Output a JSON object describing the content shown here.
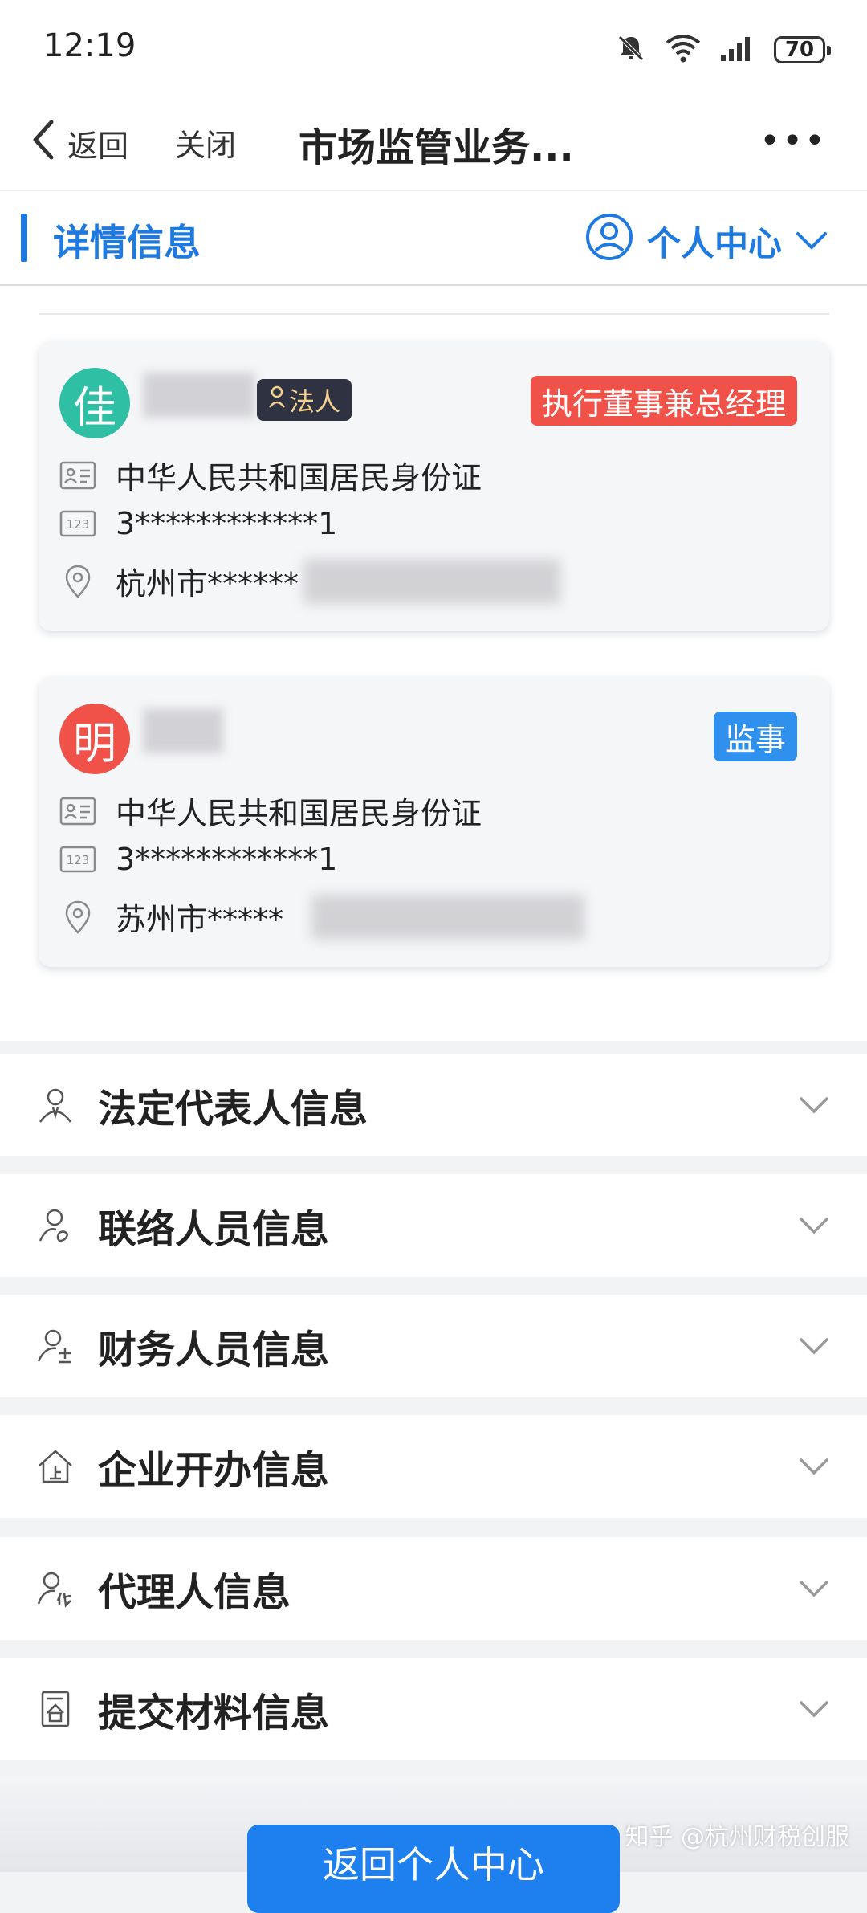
{
  "status_bar": {
    "time": "12:19",
    "battery": "70"
  },
  "nav": {
    "back_label": "返回",
    "close_label": "关闭",
    "title": "市场监管业务...",
    "more_label": "•••"
  },
  "tab": {
    "title": "详情信息",
    "personal_center": "个人中心"
  },
  "people": [
    {
      "avatar_char": "佳",
      "avatar_color": "#2ebfa5",
      "legal_tag": "法人",
      "role": "执行董事兼总经理",
      "role_color": "#f0524a",
      "id_type": "中华人民共和国居民身份证",
      "id_number": "3************1",
      "address": "杭州市******"
    },
    {
      "avatar_char": "明",
      "avatar_color": "#f0524a",
      "role": "监事",
      "role_color": "#2f90ee",
      "id_type": "中华人民共和国居民身份证",
      "id_number": "3************1",
      "address": "苏州市*****"
    }
  ],
  "sections": [
    {
      "label": "法定代表人信息",
      "icon": "legal-rep-icon"
    },
    {
      "label": "联络人员信息",
      "icon": "contact-person-icon"
    },
    {
      "label": "财务人员信息",
      "icon": "finance-person-icon"
    },
    {
      "label": "企业开办信息",
      "icon": "enterprise-icon"
    },
    {
      "label": "代理人信息",
      "icon": "agent-icon"
    },
    {
      "label": "提交材料信息",
      "icon": "document-icon"
    }
  ],
  "bottom_button": "返回个人中心",
  "watermark": "知乎 @杭州财税创服"
}
